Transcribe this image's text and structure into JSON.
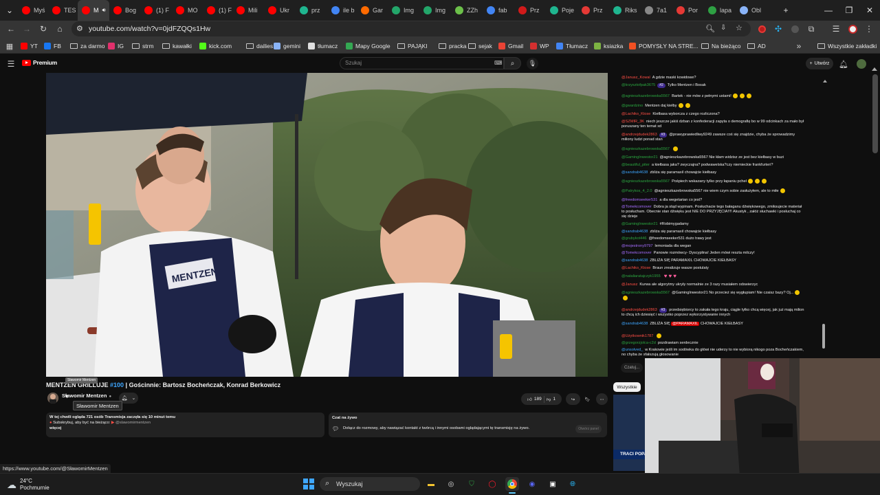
{
  "tabs": [
    {
      "label": "Myś",
      "color": "#ff0000",
      "icon": "youtube-icon"
    },
    {
      "label": "TES",
      "color": "#ff0000",
      "icon": "youtube-icon"
    },
    {
      "label": "M",
      "color": "#ff0000",
      "icon": "youtube-icon",
      "active": true
    },
    {
      "label": "Bog",
      "color": "#ff0000",
      "icon": "youtube-icon"
    },
    {
      "label": "(1) F",
      "color": "#ff0000",
      "icon": "youtube-icon"
    },
    {
      "label": "MO",
      "color": "#ff0000",
      "icon": "youtube-icon"
    },
    {
      "label": "(1) F",
      "color": "#ff0000",
      "icon": "youtube-icon"
    },
    {
      "label": "Mili",
      "color": "#ff0000",
      "icon": "youtube-icon"
    },
    {
      "label": "Ukr",
      "color": "#ff0000",
      "icon": "youtube-icon"
    },
    {
      "label": "prz",
      "color": "#1fb58f",
      "icon": "chatgpt-icon"
    },
    {
      "label": "ile b",
      "color": "#4285f4",
      "icon": "google-icon"
    },
    {
      "label": "Gar",
      "color": "#ff6a00",
      "icon": "c-icon"
    },
    {
      "label": "Img",
      "color": "#23a66a",
      "icon": "image-icon"
    },
    {
      "label": "Img",
      "color": "#23a66a",
      "icon": "image-icon"
    },
    {
      "label": "ZZh",
      "color": "#6cc04a",
      "icon": "grid-icon"
    },
    {
      "label": "fab",
      "color": "#4285f4",
      "icon": "google-icon"
    },
    {
      "label": "Prz",
      "color": "#d11a1a",
      "icon": "s-icon"
    },
    {
      "label": "Poje",
      "color": "#1fb58f",
      "icon": "chatgpt-icon"
    },
    {
      "label": "Prz",
      "color": "#e53935",
      "icon": "a-icon"
    },
    {
      "label": "Riks",
      "color": "#1fb58f",
      "icon": "chatgpt-icon"
    },
    {
      "label": "7a1",
      "color": "#888888",
      "icon": "globe-icon"
    },
    {
      "label": "Por",
      "color": "#e53935",
      "icon": "a-icon"
    },
    {
      "label": "lapa",
      "color": "#2ea043",
      "icon": "k-icon"
    },
    {
      "label": "Obl",
      "color": "#8ab4f8",
      "icon": "gemini-icon"
    }
  ],
  "address": {
    "url": "youtube.com/watch?v=0jdFZQQs1Hw"
  },
  "bookmarks": [
    {
      "label": "YT",
      "icon": "youtube-icon"
    },
    {
      "label": "FB",
      "icon": "facebook-icon"
    },
    {
      "label": "za darmo",
      "icon": "folder-icon"
    },
    {
      "label": "IG",
      "icon": "instagram-icon"
    },
    {
      "label": "strm",
      "icon": "folder-icon"
    },
    {
      "label": "kawałki",
      "icon": "folder-icon"
    },
    {
      "label": "kick.com",
      "icon": "kick-icon"
    },
    {
      "label": "dailies",
      "icon": "folder-icon"
    },
    {
      "label": "gemini",
      "icon": "gemini-icon"
    },
    {
      "label": "tłumacz",
      "icon": "openai-icon"
    },
    {
      "label": "Mapy Google",
      "icon": "maps-icon"
    },
    {
      "label": "PAJĄKI",
      "icon": "folder-icon"
    },
    {
      "label": "pracka",
      "icon": "folder-icon"
    },
    {
      "label": "sejak",
      "icon": "folder-icon"
    },
    {
      "label": "Gmail",
      "icon": "gmail-icon"
    },
    {
      "label": "WP",
      "icon": "wp-icon"
    },
    {
      "label": "Tłumacz",
      "icon": "translate-icon"
    },
    {
      "label": "ksiazka",
      "icon": "grid-icon"
    },
    {
      "label": "POMYSŁY NA STRE...",
      "icon": "ms-icon"
    },
    {
      "label": "Na bieżąco",
      "icon": "folder-icon"
    },
    {
      "label": "AD",
      "icon": "folder-icon"
    }
  ],
  "bookmarks_all": "Wszystkie zakładki",
  "youtube": {
    "logo": "Premium",
    "search_placeholder": "Szukaj",
    "create_label": "Utwórz"
  },
  "video": {
    "title_prefix": "MENTZEN GRILLUJE ",
    "title_hash": "#100",
    "title_rest": " | Gościnnie: Bartosz Bocheńczak, Konrad Berkowicz",
    "tooltip_small": "Sławomir Mentzen",
    "channel": "Sławomir Mentzen",
    "tooltip_channel": "Sławomir Mentzen",
    "likes": "189",
    "dislikes": "1",
    "desc_line1": "W tej chwili ogląda 721 osób  Transmisja zaczęła się 10 minut temu",
    "desc_line2": "Subskrybuj, aby być na bieżąco:",
    "desc_handle": "@slawomirmentzen",
    "desc_more": "więcej",
    "livechat_title": "Czat na żywo",
    "livechat_text": "Dołącz do rozmowy, aby nawiązać kontakt z twórcą i innymi osobami oglądającymi tę transmisję na żywo.",
    "livechat_btn": "Otwórz panel",
    "rec_chip": "Wszystkie",
    "rec_thumb_text": "TRACI POPAR"
  },
  "chat": {
    "input_placeholder": "Czatuj...",
    "messages": [
      {
        "author": "@Janusz_Kowal",
        "color": "#ff4e45",
        "text": "A gdzie maski kowidowe?"
      },
      {
        "author": "@krzysztofpak3675",
        "color": "#2ba640",
        "badge": "#2",
        "text": "Tylko Mentzen i Bosak"
      },
      {
        "author": "@agnieszkazebrowska5567",
        "color": "#2ba640",
        "text": "Bartek - nie mów z pełnymi ustami!",
        "emoji": 3
      },
      {
        "author": "@gwardzino",
        "color": "#2ba640",
        "text": "Mentzen daj kiełby",
        "emoji": 2
      },
      {
        "author": "@Lachiko_Ktose",
        "color": "#ff4e45",
        "text": "Kiełbasa wyborcza z czego rozliczona?"
      },
      {
        "author": "@SZMIR_3K",
        "color": "#ff4e45",
        "text": "niech jeszcze jakiś dzban z konfederacji zapyta o demografię bo w 99 odcinkach za mało był poruszany ten temat xd"
      },
      {
        "author": "@andrzejdudek2863",
        "color": "#ff4e45",
        "badge": "#3",
        "text": "@prawyprawiedliwy9249 zawsze coś się znajdzie, chyba że sprowadzimy miliony ludzi ponad stan"
      },
      {
        "author": "@agnieszkazebrowska5567",
        "color": "#2ba640",
        "text": "",
        "emoji": 1
      },
      {
        "author": "@GamingInwestor21",
        "color": "#2ba640",
        "text": "@agnieszkazebrowska5567 Nie kłam widzisz ze jest bez kiełbasy w buzi"
      },
      {
        "author": "@beautiful_piter",
        "color": "#2ba640",
        "text": "a kiełbasa jaka? zwyczajna? podwawelska?czy niemieckie frankfurteri?"
      },
      {
        "author": "@sandrab4638",
        "color": "#3ea6ff",
        "text": "zbliża się paramaxil chowajcie kiełbasy"
      },
      {
        "author": "@agnieszkazebrowska5567",
        "color": "#2ba640",
        "text": "Pośpiech wskazany tylko przy łapaniu pcheł",
        "emoji": 3
      },
      {
        "author": "@Patrykos_4_2.0",
        "color": "#2ba640",
        "text": "@agnieszkazebrowska5567 nie wiem czym sobie zasłużyłem, ale to miłe",
        "emoji": 1
      },
      {
        "author": "@freedomseeker531",
        "color": "#a66dff",
        "text": "a dla wegetarian co jest?"
      },
      {
        "author": "@Tomekcomover",
        "color": "#a66dff",
        "text": "Dobra ja stąd wypinam. Posłuchacie tego bałaganu dźwiękowego, zmiksujecie materiał to posłucham. Obecnie stan dźwięku jest NIE DO PRZYJĘCIA!!!! Akustyk , załóż słuchawki i posłuchaj co się dzieje"
      },
      {
        "author": "@GamingInwestor21",
        "color": "#2ba640",
        "text": "#Robimygadamy"
      },
      {
        "author": "@sandrab4638",
        "color": "#3ea6ff",
        "text": "zbliża się paramaxil chowajcie kiełbasy"
      },
      {
        "author": "@grubykot446",
        "color": "#2ba640",
        "text": "@freedomseeker531 dużo trawy jest"
      },
      {
        "author": "@mojestrony9797",
        "color": "#a66dff",
        "text": "lemoniada dla wegan"
      },
      {
        "author": "@Tomekcomover",
        "color": "#a66dff",
        "text": "Panowie rozmówcy- Dyscyplina! Jeden mówi reszta milczy!"
      },
      {
        "author": "@sandrab4638",
        "color": "#3ea6ff",
        "text": "ZBLIŻA SIĘ PARAMAXIL CHOWAJCIE KIEŁBASY"
      },
      {
        "author": "@Lachiko_Ktose",
        "color": "#ff4e45",
        "text": "Braun zrealizuje wasze postulaty"
      },
      {
        "author": "@nataliaratajczyk1955",
        "color": "#2ba640",
        "text": "",
        "hearts": 3
      },
      {
        "author": "@Janusz",
        "color": "#ff4e45",
        "text": "Kurwa ale algorytmy ukryły normalnie ze 3 razy musiałem odswierzyc"
      },
      {
        "author": "@agnieszkazebrowska5567",
        "color": "#2ba640",
        "text": "@GamingInwestor21 No przecież się wygłupiam!",
        "tail": "Nie czaisz bazy? Oj...",
        "emoji": 2
      },
      {
        "author": "@andrzejdudek2863",
        "color": "#ff4e45",
        "badge": "#3",
        "text": "przedsiębiorcy to zakała tego kraju, ciągle tylko chcą więcej, jak już mają milion to chcą ich dziesięć i wszystko poprzez wykorzystywanie innych"
      },
      {
        "author": "@sandrab4638",
        "color": "#3ea6ff",
        "text": "ZBLIŻA SIĘ",
        "highlight": "@PARAMAXIL",
        "tail": "CHOWAJCIE KIEŁBASY"
      },
      {
        "author": "@Użytkownik1787",
        "color": "#ff4e45",
        "text": "",
        "emoji": 1
      },
      {
        "author": "@grzegorzjolca-c2d",
        "color": "#2ba640",
        "text": "pozdrawiam serdecznie"
      },
      {
        "author": "@unsolved_",
        "color": "#3ea6ff",
        "text": "w Krakowie jeśli im sodówka do główi nie uderzy to nie wybiorą nikogo poza Bocheńczakiem, no chyba że sfałszują głosowanie"
      }
    ]
  },
  "status_url": "https://www.youtube.com/@SławomirMentzen",
  "taskbar": {
    "weather_temp": "24°C",
    "weather_desc": "Pochmurnie",
    "search_label": "Wyszukaj"
  }
}
